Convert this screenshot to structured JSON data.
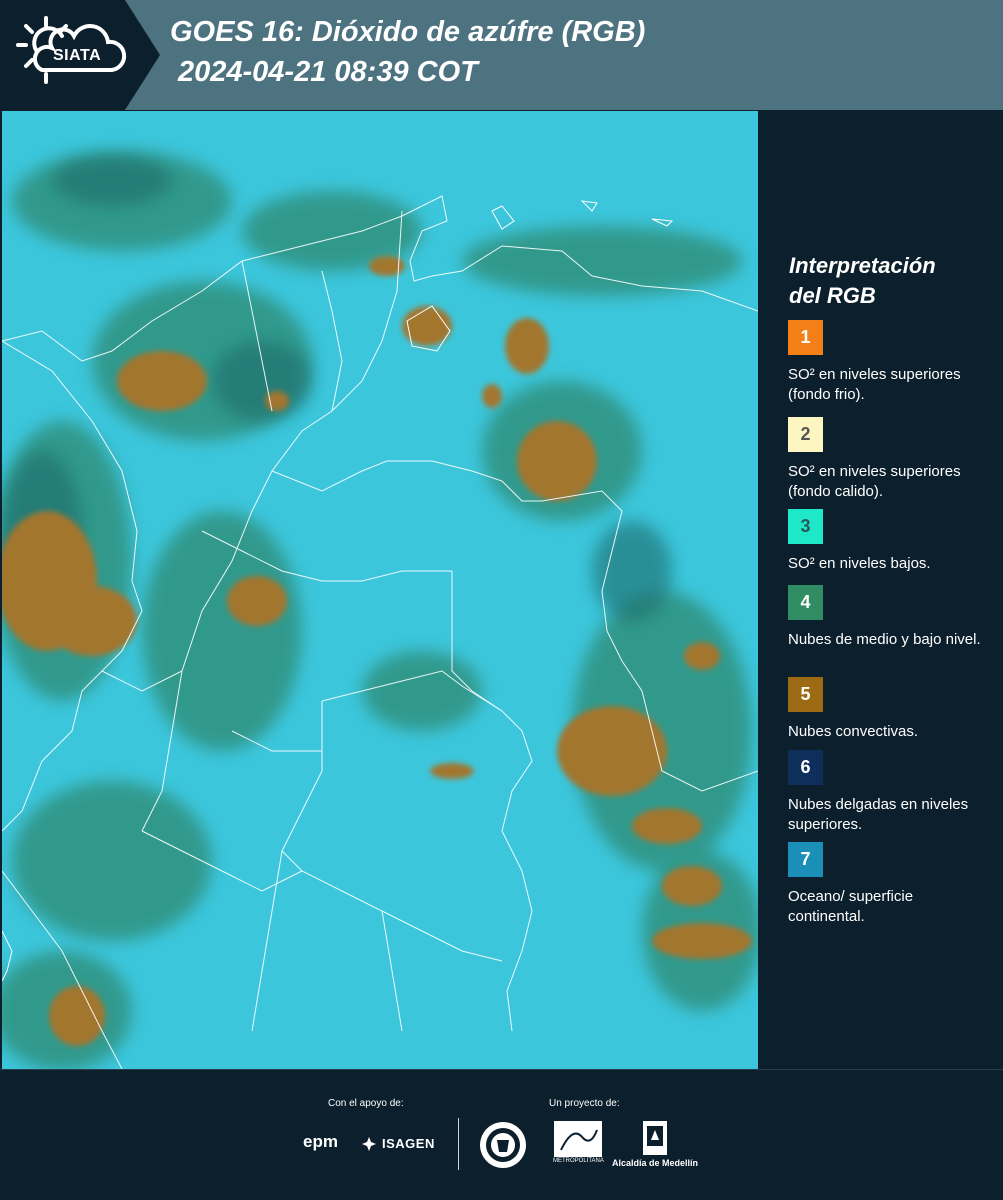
{
  "header": {
    "logo_text": "SIATA",
    "title_line1": "GOES 16: Dióxido de azúfre (RGB)",
    "title_line2": "2024-04-21 08:39 COT"
  },
  "colors": {
    "header_bg": "#4d7280",
    "panel_bg": "#0c1f2c",
    "map_base": "#35c2d9",
    "border_lines": "#ffffff"
  },
  "legend": {
    "title_line1": "Interpretación",
    "title_line2": "del RGB",
    "items": [
      {
        "number": "1",
        "color": "#f57f17",
        "text": "SO² en niveles superiores (fondo frio)."
      },
      {
        "number": "2",
        "color": "#fdf6c3",
        "text": "SO² en niveles superiores (fondo calido)."
      },
      {
        "number": "3",
        "color": "#1de9c9",
        "text": "SO² en niveles bajos."
      },
      {
        "number": "4",
        "color": "#2f8c63",
        "text": "Nubes de medio y bajo nivel."
      },
      {
        "number": "5",
        "color": "#9c6a12",
        "text": "Nubes convectivas."
      },
      {
        "number": "6",
        "color": "#0e2f5c",
        "text": "Nubes delgadas en niveles superiores."
      },
      {
        "number": "7",
        "color": "#1a8fb8",
        "text": "Oceano/ superficie continental."
      }
    ]
  },
  "footer": {
    "support_label": "Con el apoyo de:",
    "project_label": "Un proyecto de:",
    "epm": "epm",
    "isagen": "ISAGEN",
    "area_metropolitana": "METROPOLITANA",
    "alcaldia": "Alcaldía de Medellín"
  }
}
